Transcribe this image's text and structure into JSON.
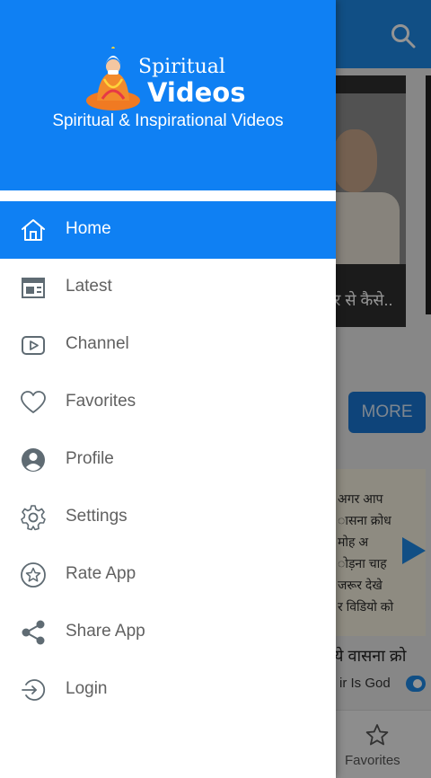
{
  "drawer": {
    "logo_line1": "Spiritual",
    "logo_line2": "Videos",
    "tagline": "Spiritual & Inspirational Videos",
    "items": [
      {
        "label": "Home",
        "icon": "home-icon",
        "active": true
      },
      {
        "label": "Latest",
        "icon": "calendar-icon",
        "active": false
      },
      {
        "label": "Channel",
        "icon": "play-channel-icon",
        "active": false
      },
      {
        "label": "Favorites",
        "icon": "heart-icon",
        "active": false
      },
      {
        "label": "Profile",
        "icon": "profile-icon",
        "active": false
      },
      {
        "label": "Settings",
        "icon": "gear-icon",
        "active": false
      },
      {
        "label": "Rate App",
        "icon": "star-icon",
        "active": false
      },
      {
        "label": "Share App",
        "icon": "share-icon",
        "active": false
      },
      {
        "label": "Login",
        "icon": "login-icon",
        "active": false
      }
    ]
  },
  "background": {
    "card1_title": "र से कैसे..",
    "more_label": "MORE",
    "card2_lines": [
      "अगर आप",
      "ासना  क्रोध",
      "मोह  अ",
      "ोड़ना चाह",
      "जरूर देखे",
      "र विडियो को"
    ],
    "card2_title": "ये वासना क्रो",
    "card2_channel": "ir Is God",
    "bottom_nav_label": "Favorites"
  },
  "colors": {
    "primary": "#0f80f3",
    "topbar": "#1e88e5",
    "drawer_text": "#616161",
    "drawer_icon": "#5f6b73"
  }
}
